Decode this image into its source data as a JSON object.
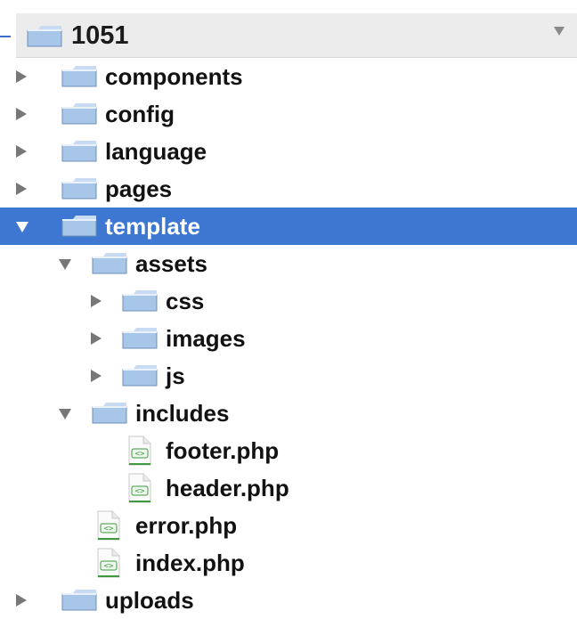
{
  "project": {
    "title": "1051",
    "folder_icon": "folder-icon",
    "caret_icon": "chevron-down-icon"
  },
  "tree": [
    {
      "label": "components",
      "kind": "folder",
      "level": 0,
      "expanded": false,
      "selected": false
    },
    {
      "label": "config",
      "kind": "folder",
      "level": 0,
      "expanded": false,
      "selected": false
    },
    {
      "label": "language",
      "kind": "folder",
      "level": 0,
      "expanded": false,
      "selected": false
    },
    {
      "label": "pages",
      "kind": "folder",
      "level": 0,
      "expanded": false,
      "selected": false
    },
    {
      "label": "template",
      "kind": "folder",
      "level": 0,
      "expanded": true,
      "selected": true
    },
    {
      "label": "assets",
      "kind": "folder",
      "level": 1,
      "expanded": true,
      "selected": false
    },
    {
      "label": "css",
      "kind": "folder",
      "level": 2,
      "expanded": false,
      "selected": false
    },
    {
      "label": "images",
      "kind": "folder",
      "level": 2,
      "expanded": false,
      "selected": false
    },
    {
      "label": "js",
      "kind": "folder",
      "level": 2,
      "expanded": false,
      "selected": false
    },
    {
      "label": "includes",
      "kind": "folder",
      "level": 1,
      "expanded": true,
      "selected": false
    },
    {
      "label": "footer.php",
      "kind": "file",
      "level": 2,
      "expanded": false,
      "selected": false
    },
    {
      "label": "header.php",
      "kind": "file",
      "level": 2,
      "expanded": false,
      "selected": false
    },
    {
      "label": "error.php",
      "kind": "file",
      "level": 1,
      "expanded": false,
      "selected": false
    },
    {
      "label": "index.php",
      "kind": "file",
      "level": 1,
      "expanded": false,
      "selected": false
    },
    {
      "label": "uploads",
      "kind": "folder",
      "level": 0,
      "expanded": false,
      "selected": false
    }
  ],
  "colors": {
    "selection": "#3e77d1",
    "folder_fill": "#a7c6e8",
    "folder_tab": "#c9dbf2",
    "text": "#121212",
    "chevron": "#777777",
    "php_icon_green": "#3f9a3f"
  }
}
